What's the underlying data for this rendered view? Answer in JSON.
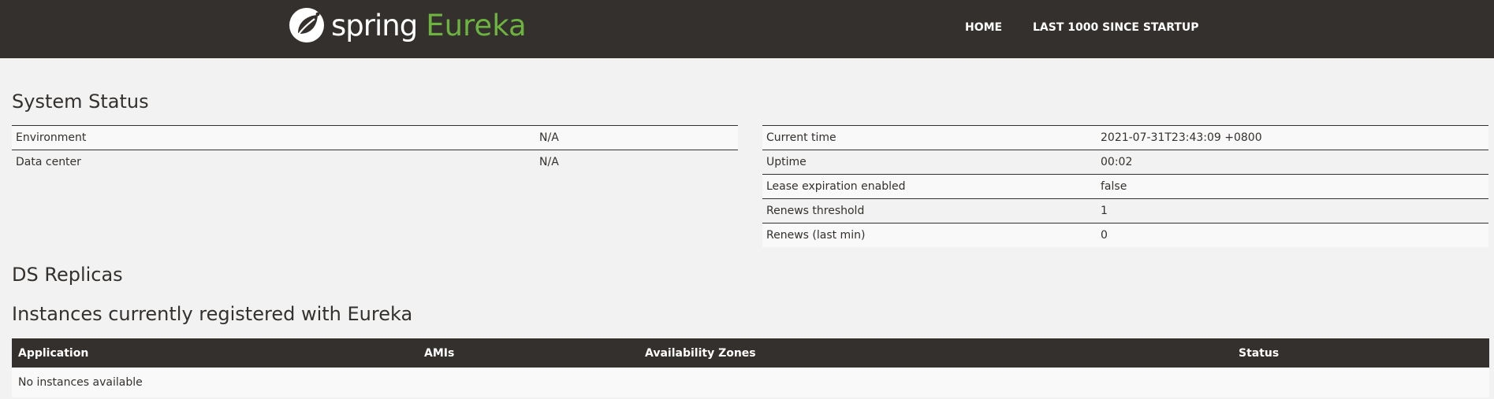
{
  "header": {
    "brand_spring": "spring",
    "brand_eureka": "Eureka",
    "nav": {
      "home": "HOME",
      "last": "LAST 1000 SINCE STARTUP"
    },
    "colors": {
      "background": "#34302d",
      "accent": "#6db33f"
    }
  },
  "system_status": {
    "title": "System Status",
    "left": [
      {
        "label": "Environment",
        "value": "N/A"
      },
      {
        "label": "Data center",
        "value": "N/A"
      }
    ],
    "right": [
      {
        "label": "Current time",
        "value": "2021-07-31T23:43:09 +0800"
      },
      {
        "label": "Uptime",
        "value": "00:02"
      },
      {
        "label": "Lease expiration enabled",
        "value": "false"
      },
      {
        "label": "Renews threshold",
        "value": "1"
      },
      {
        "label": "Renews (last min)",
        "value": "0"
      }
    ]
  },
  "ds_replicas": {
    "title": "DS Replicas"
  },
  "instances": {
    "title": "Instances currently registered with Eureka",
    "columns": [
      "Application",
      "AMIs",
      "Availability Zones",
      "Status"
    ],
    "empty_message": "No instances available"
  }
}
